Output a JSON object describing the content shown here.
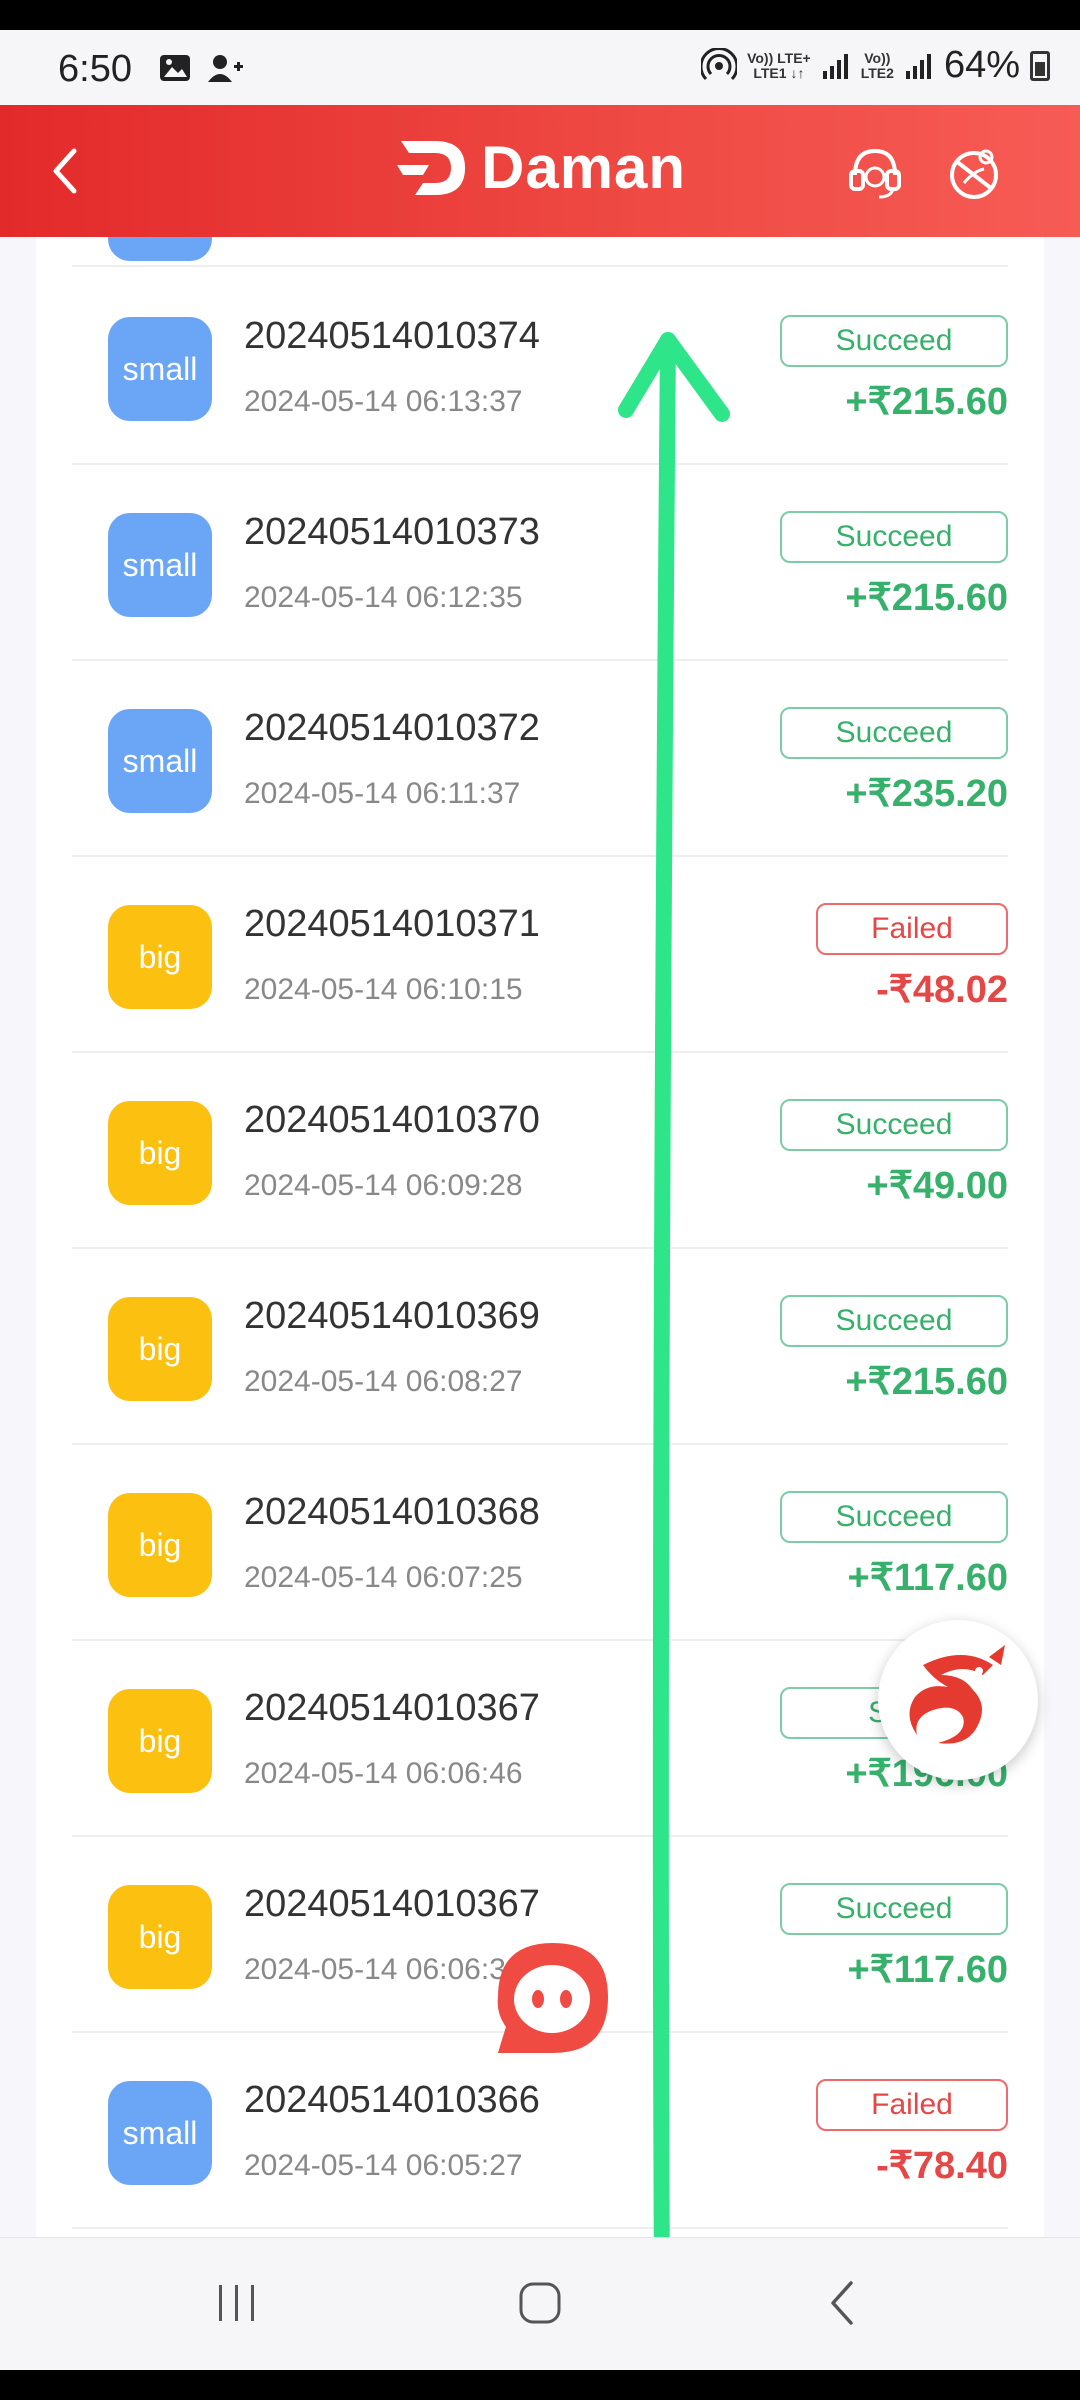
{
  "status_bar": {
    "time": "6:50",
    "battery": "64%",
    "net1_top": "Vo)) LTE+",
    "net1_bottom": "LTE1 ↓↑",
    "net2_top": "Vo))",
    "net2_bottom": "LTE2"
  },
  "header": {
    "brand": "Daman",
    "accent_color": "#e32a2a"
  },
  "records": [
    {
      "type": "small",
      "order": "20240514010374",
      "time": "2024-05-14 06:13:37",
      "status": "Succeed",
      "amount": "+₹215.60"
    },
    {
      "type": "small",
      "order": "20240514010373",
      "time": "2024-05-14 06:12:35",
      "status": "Succeed",
      "amount": "+₹215.60"
    },
    {
      "type": "small",
      "order": "20240514010372",
      "time": "2024-05-14 06:11:37",
      "status": "Succeed",
      "amount": "+₹235.20"
    },
    {
      "type": "big",
      "order": "20240514010371",
      "time": "2024-05-14 06:10:15",
      "status": "Failed",
      "amount": "-₹48.02"
    },
    {
      "type": "big",
      "order": "20240514010370",
      "time": "2024-05-14 06:09:28",
      "status": "Succeed",
      "amount": "+₹49.00"
    },
    {
      "type": "big",
      "order": "20240514010369",
      "time": "2024-05-14 06:08:27",
      "status": "Succeed",
      "amount": "+₹215.60"
    },
    {
      "type": "big",
      "order": "20240514010368",
      "time": "2024-05-14 06:07:25",
      "status": "Succeed",
      "amount": "+₹117.60"
    },
    {
      "type": "big",
      "order": "20240514010367",
      "time": "2024-05-14 06:06:46",
      "status": "Suc",
      "amount": "+₹196.00"
    },
    {
      "type": "big",
      "order": "20240514010367",
      "time": "2024-05-14 06:06:3",
      "status": "Succeed",
      "amount": "+₹117.60"
    },
    {
      "type": "small",
      "order": "20240514010366",
      "time": "2024-05-14 06:05:27",
      "status": "Failed",
      "amount": "-₹78.40"
    }
  ],
  "icons": {
    "back": "back-arrow-icon",
    "support": "headset-icon",
    "language": "globe-icon",
    "overlay_arrow": "up-arrow-icon",
    "dragon": "dragon-logo-icon",
    "chat": "chat-bubble-icon"
  },
  "colors": {
    "success": "#36b06b",
    "failed": "#e54646",
    "small_badge": "#6aa6f5",
    "big_badge": "#fcc110",
    "overlay_arrow": "#2ee58a"
  }
}
